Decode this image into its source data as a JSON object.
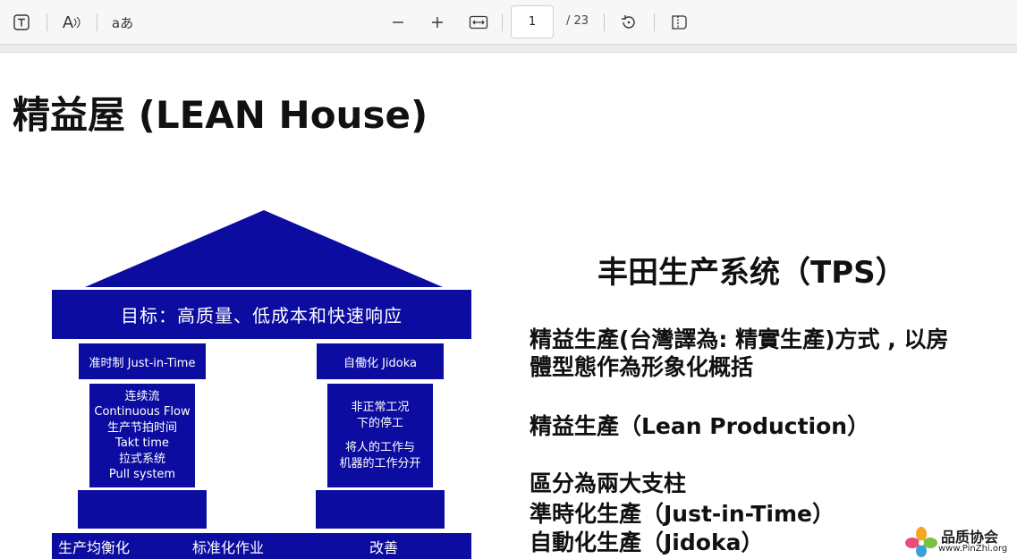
{
  "toolbar": {
    "page_current": "1",
    "page_total": "/ 23",
    "icons": [
      "text-box-icon",
      "read-aloud-icon",
      "translate-icon",
      "zoom-out-icon",
      "zoom-in-icon",
      "fit-width-icon",
      "rotate-icon",
      "two-page-view-icon"
    ],
    "read_aloud_glyph": "A",
    "translate_glyph": "aあ"
  },
  "slide": {
    "title": "精益屋 (LEAN House)",
    "house": {
      "roof_color": "#0c0ca0",
      "beam": "目标：高质量、低成本和快速响应",
      "left_pillar": {
        "head": "准时制 Just-in-Time",
        "body": [
          "连续流",
          "Continuous Flow",
          "生产节拍时间",
          "Takt time",
          "拉式系统",
          "Pull system"
        ]
      },
      "right_pillar": {
        "head": "自働化 Jidoka",
        "body": [
          "非正常工况",
          "下的停工",
          "",
          "将人的工作与",
          "机器的工作分开"
        ]
      },
      "base": [
        "生产均衡化",
        "标准化作业",
        "改善"
      ]
    },
    "tps_title": "丰田生产系统（TPS）",
    "paragraphs": [
      "精益生產(台灣譯為: 精實生產)方式 , 以房",
      "體型態作為形象化概括",
      "精益生產（Lean Production）",
      "區分為兩大支柱",
      "準時化生產（Just-in-Time）",
      "自動化生產（Jidoka）"
    ]
  },
  "watermark": {
    "name": "品质协会",
    "url": "www.PinZhi.org"
  }
}
